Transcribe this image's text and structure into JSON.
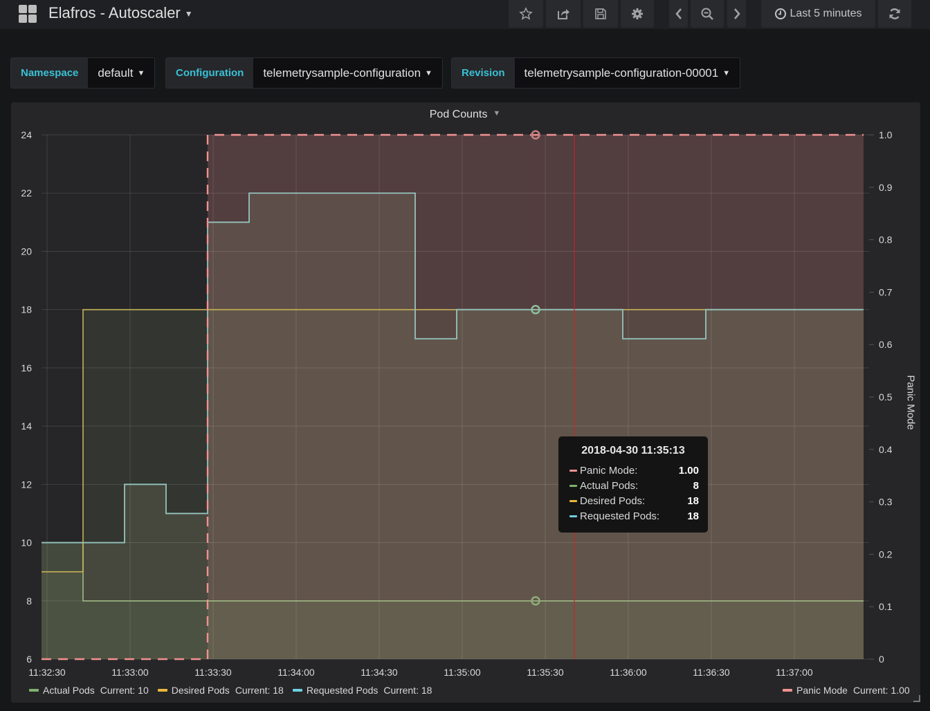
{
  "header": {
    "title": "Elafros - Autoscaler",
    "time_range_label": "Last 5 minutes",
    "icons": [
      "grid-icon",
      "star-icon",
      "share-icon",
      "save-icon",
      "gear-icon",
      "chevron-left-icon",
      "zoom-out-icon",
      "chevron-right-icon",
      "clock-icon",
      "refresh-icon"
    ]
  },
  "variables": [
    {
      "label": "Namespace",
      "value": "default"
    },
    {
      "label": "Configuration",
      "value": "telemetrysample-configuration"
    },
    {
      "label": "Revision",
      "value": "telemetrysample-configuration-00001"
    }
  ],
  "panel": {
    "title": "Pod Counts"
  },
  "tooltip": {
    "time": "2018-04-30 11:35:13",
    "rows": [
      {
        "name": "Panic Mode:",
        "value": "1.00",
        "color": "#f29191"
      },
      {
        "name": "Actual Pods:",
        "value": "8",
        "color": "#7eb26d"
      },
      {
        "name": "Desired Pods:",
        "value": "18",
        "color": "#eab839"
      },
      {
        "name": "Requested Pods:",
        "value": "18",
        "color": "#6ed0e0"
      }
    ]
  },
  "legend": {
    "left": [
      {
        "name": "Actual Pods",
        "current": "Current: 10",
        "color": "#7eb26d"
      },
      {
        "name": "Desired Pods",
        "current": "Current: 18",
        "color": "#eab839"
      },
      {
        "name": "Requested Pods",
        "current": "Current: 18",
        "color": "#6ed0e0"
      }
    ],
    "right": [
      {
        "name": "Panic Mode",
        "current": "Current: 1.00",
        "color": "#f29191"
      }
    ]
  },
  "chart_data": {
    "type": "line",
    "title": "Pod Counts",
    "xlabel": "",
    "ylabel": "",
    "y2label": "Panic Mode",
    "x_ticks": [
      "11:32:30",
      "11:33:00",
      "11:33:30",
      "11:34:00",
      "11:34:30",
      "11:35:00",
      "11:35:30",
      "11:36:00",
      "11:36:30",
      "11:37:00"
    ],
    "y_ticks": [
      6,
      8,
      10,
      12,
      14,
      16,
      18,
      20,
      22,
      24
    ],
    "y2_ticks": [
      "0",
      "0.1",
      "0.2",
      "0.3",
      "0.4",
      "0.5",
      "0.6",
      "0.7",
      "0.8",
      "0.9",
      "1.0"
    ],
    "ylim": [
      6,
      24
    ],
    "y2lim": [
      0,
      1
    ],
    "xlim_seconds_from_113230": [
      -2,
      295
    ],
    "grid": true,
    "stepped": true,
    "hover_time_seconds_from_113230": 176.5,
    "series": [
      {
        "name": "Requested Pods",
        "color": "#6ed0e0",
        "axis": "left",
        "steps": [
          [
            -2,
            10
          ],
          [
            28,
            12
          ],
          [
            43,
            11
          ],
          [
            58,
            21
          ],
          [
            73,
            22
          ],
          [
            133,
            17
          ],
          [
            148,
            18
          ],
          [
            208,
            17
          ],
          [
            238,
            18
          ],
          [
            295,
            18
          ]
        ]
      },
      {
        "name": "Desired Pods",
        "color": "#eab839",
        "axis": "left",
        "steps": [
          [
            -2,
            9
          ],
          [
            13,
            18
          ],
          [
            295,
            18
          ]
        ]
      },
      {
        "name": "Actual Pods",
        "color": "#7eb26d",
        "axis": "left",
        "steps": [
          [
            -2,
            10
          ],
          [
            13,
            8
          ],
          [
            295,
            8
          ]
        ]
      },
      {
        "name": "Panic Mode",
        "color": "#f29191",
        "axis": "right",
        "steps": [
          [
            -2,
            0
          ],
          [
            58,
            1
          ],
          [
            295,
            1
          ]
        ]
      }
    ]
  }
}
